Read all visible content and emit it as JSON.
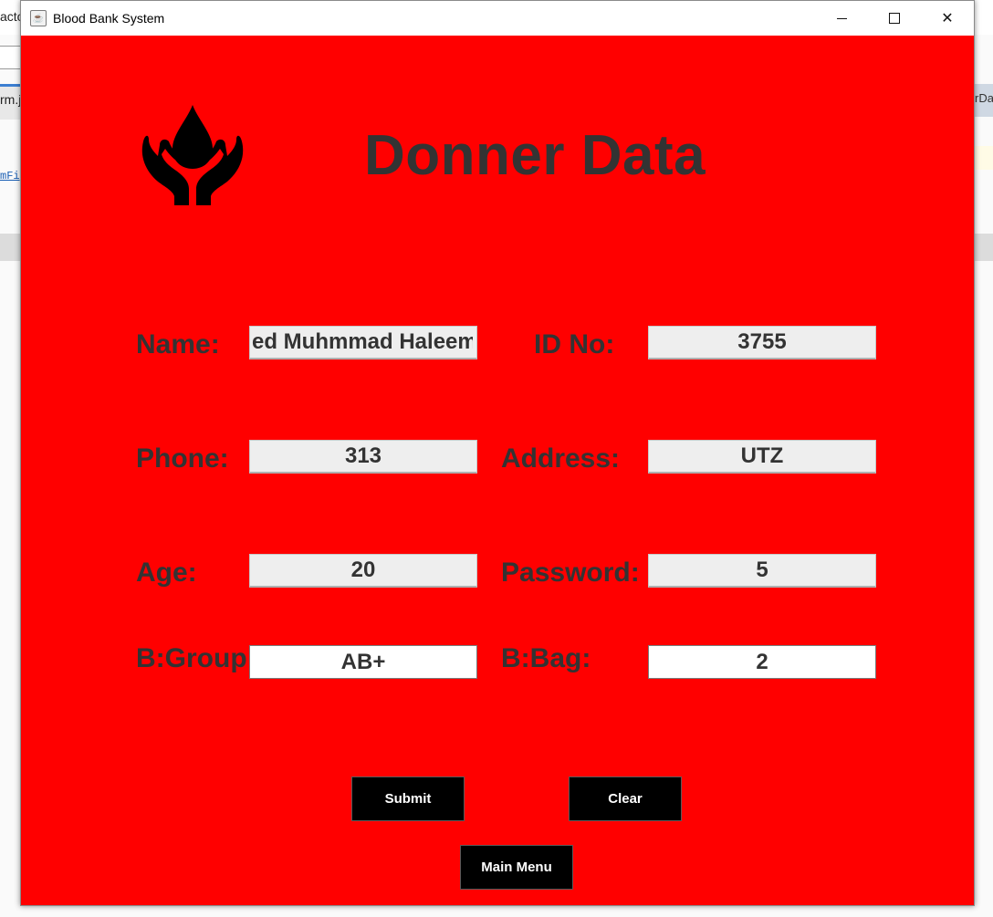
{
  "background": {
    "left_texts": [
      "acto",
      "rm.j",
      "mFi"
    ],
    "right_tab": "rDa"
  },
  "window": {
    "title": "Blood Bank System",
    "icon": "java-cup-icon",
    "controls": {
      "minimize": "minimize-icon",
      "maximize": "maximize-icon",
      "close": "✕"
    }
  },
  "form": {
    "heading": "Donner Data",
    "logo_icon": "blood-drop-hands-icon",
    "fields": {
      "name": {
        "label": "Name:",
        "value": "ed Muhmmad Haleem"
      },
      "id_no": {
        "label": "ID No:",
        "value": "3755"
      },
      "phone": {
        "label": "Phone:",
        "value": "313"
      },
      "address": {
        "label": "Address:",
        "value": "UTZ"
      },
      "age": {
        "label": "Age:",
        "value": "20"
      },
      "password": {
        "label": "Password:",
        "value": "5"
      },
      "b_group": {
        "label": "B:Group",
        "value": "AB+"
      },
      "b_bag": {
        "label": "B:Bag:",
        "value": "2"
      }
    },
    "buttons": {
      "submit": "Submit",
      "clear": "Clear",
      "main_menu": "Main Menu"
    }
  },
  "colors": {
    "window_bg": "#ff0000",
    "label_text": "#333333",
    "button_bg": "#000000",
    "button_text": "#ffffff"
  }
}
